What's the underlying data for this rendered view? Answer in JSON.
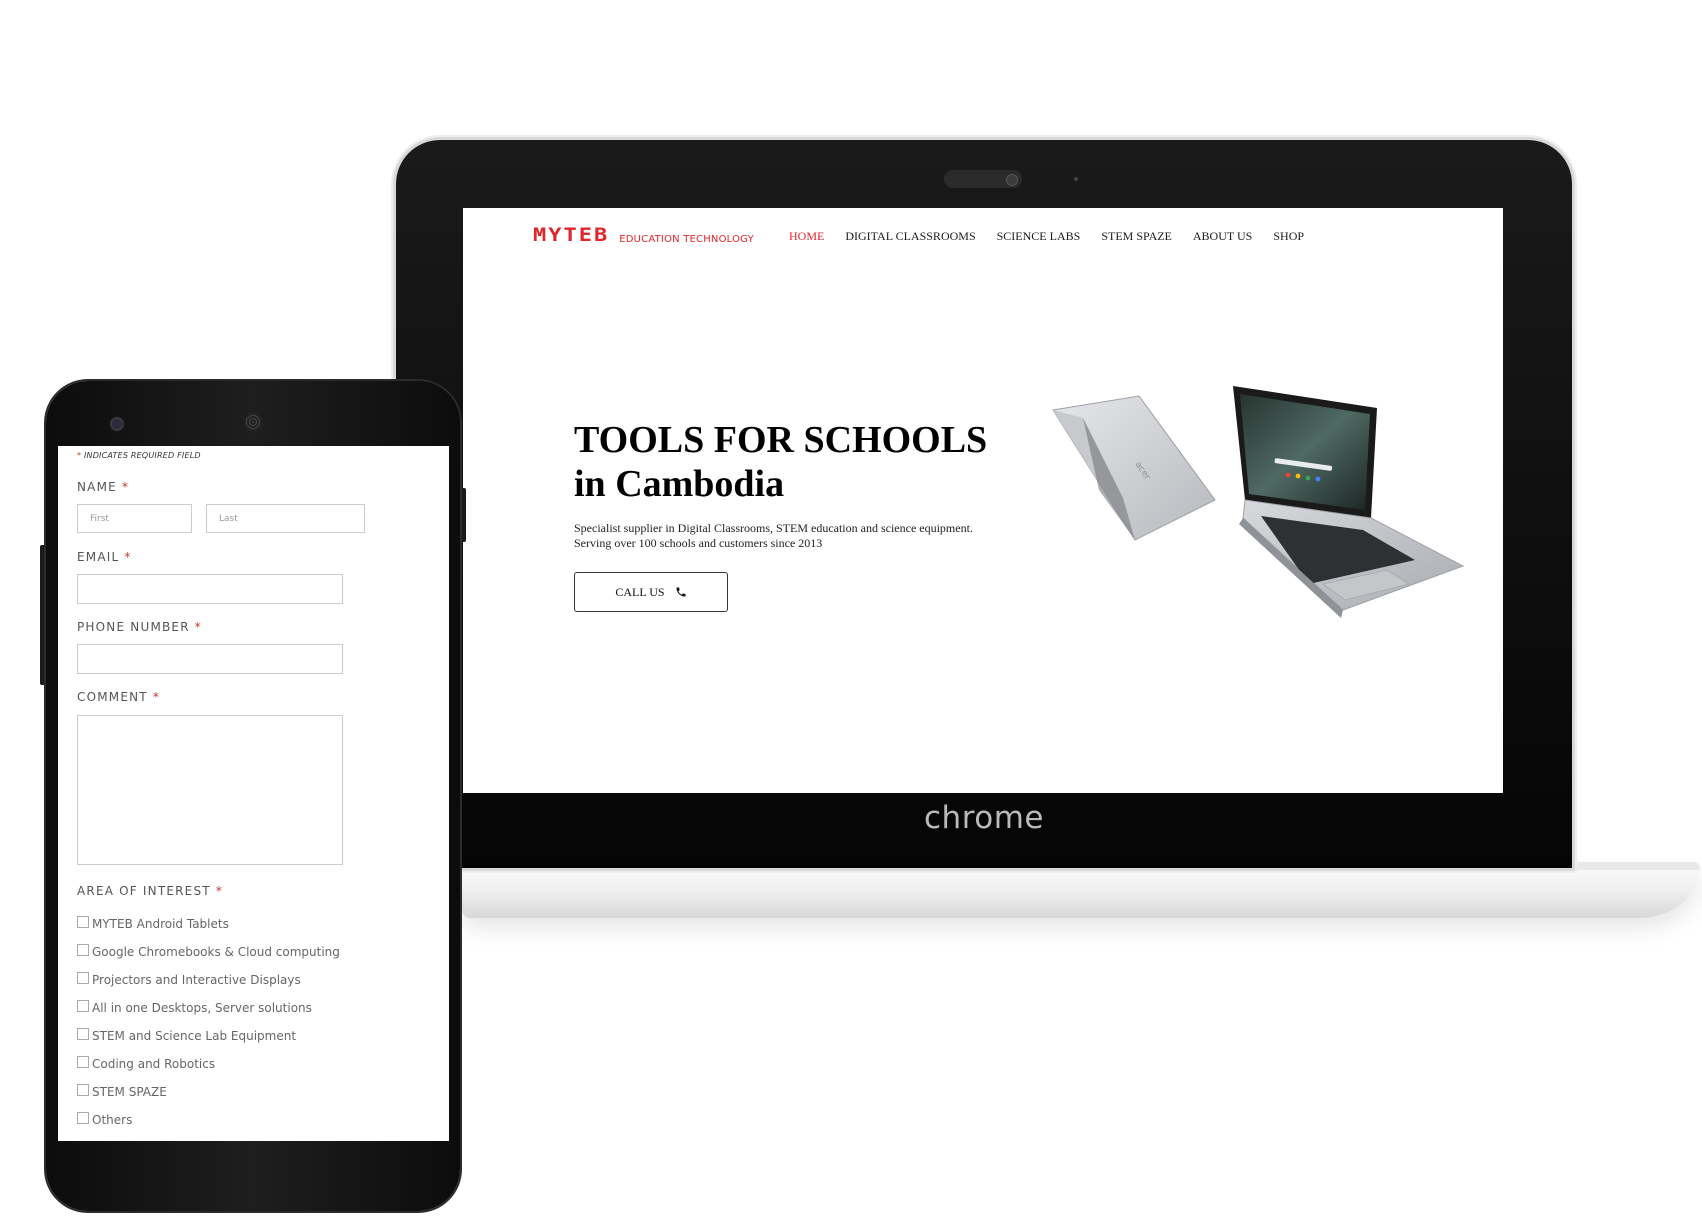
{
  "laptop": {
    "brand_text": "chrome",
    "site": {
      "logo": {
        "mark": "MYTEB",
        "tagline": "EDUCATION TECHNOLOGY",
        "color": "#e0262b"
      },
      "nav": [
        {
          "label": "HOME",
          "active": true
        },
        {
          "label": "DIGITAL CLASSROOMS",
          "active": false
        },
        {
          "label": "SCIENCE LABS",
          "active": false
        },
        {
          "label": "STEM SPAZE",
          "active": false
        },
        {
          "label": "ABOUT US",
          "active": false
        },
        {
          "label": "SHOP",
          "active": false
        }
      ],
      "hero": {
        "title_line1": "TOOLS FOR SCHOOLS",
        "title_line2": "in Cambodia",
        "desc_line1": "Specialist supplier in Digital Classrooms, STEM education and science equipment.",
        "desc_line2": "Serving over 100 schools and customers since 2013",
        "cta_label": "CALL US",
        "cta_icon": "phone-icon"
      }
    }
  },
  "phone": {
    "form": {
      "required_note_star": "*",
      "required_note": "INDICATES REQUIRED FIELD",
      "required_star": "*",
      "name_label": "NAME",
      "name_first_placeholder": "First",
      "name_last_placeholder": "Last",
      "email_label": "EMAIL",
      "phone_label": "PHONE NUMBER",
      "comment_label": "COMMENT",
      "interest_label": "AREA OF INTEREST",
      "interest_options": [
        "MYTEB Android Tablets",
        "Google Chromebooks & Cloud computing",
        "Projectors and Interactive Displays",
        "All in one Desktops, Server solutions",
        "STEM and Science Lab Equipment",
        "Coding and Robotics",
        "STEM SPAZE",
        "Others"
      ]
    }
  },
  "colors": {
    "accent": "#e0262b",
    "required_star": "#c0392b"
  }
}
